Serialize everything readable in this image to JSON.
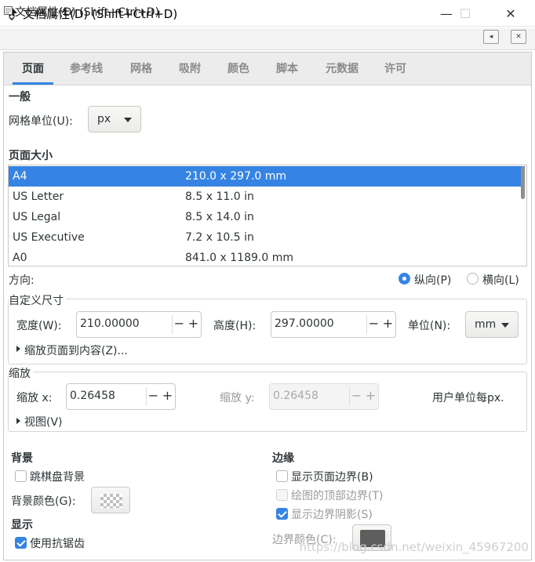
{
  "window": {
    "title": "文档属性(D) (Shift+Ctrl+D)",
    "minimize_glyph": "—",
    "maximize_glyph": "☐",
    "close_glyph": "✕"
  },
  "dock": {
    "title": "文档属性(D) (Shift+Ctrl+D)",
    "btn_float_glyph": "◂",
    "btn_close_glyph": "✕"
  },
  "tabs": [
    "页面",
    "参考线",
    "网格",
    "吸附",
    "颜色",
    "脚本",
    "元数据",
    "许可"
  ],
  "general": {
    "title": "一般",
    "unit_label": "网格单位(U):",
    "unit_value": "px"
  },
  "page_size": {
    "title": "页面大小",
    "rows": [
      {
        "name": "A4",
        "size": "210.0 x 297.0 mm"
      },
      {
        "name": "US Letter",
        "size": "8.5 x 11.0 in"
      },
      {
        "name": "US Legal",
        "size": "8.5 x 14.0 in"
      },
      {
        "name": "US Executive",
        "size": "7.2 x 10.5 in"
      },
      {
        "name": "A0",
        "size": "841.0 x 1189.0 mm"
      }
    ],
    "selected_index": 0
  },
  "orientation": {
    "label": "方向:",
    "portrait": "纵向(P)",
    "landscape": "横向(L)",
    "selected": "portrait"
  },
  "custom_size": {
    "title": "自定义尺寸",
    "width_label": "宽度(W):",
    "width_value": "210.00000",
    "height_label": "高度(H):",
    "height_value": "297.00000",
    "unit_label": "单位(N):",
    "unit_value": "mm",
    "fit_expander": "缩放页面到内容(Z)..."
  },
  "scale": {
    "title": "缩放",
    "x_label": "缩放 x:",
    "x_value": "0.26458",
    "y_label": "缩放 y:",
    "y_value": "0.26458",
    "units_note": "用户单位每px.",
    "view_expander": "视图(V)"
  },
  "background": {
    "title": "背景",
    "checkerboard_label": "跳棋盘背景",
    "checkerboard_checked": false,
    "color_label": "背景颜色(G):"
  },
  "display": {
    "title": "显示",
    "antialias_label": "使用抗锯齿",
    "antialias_checked": true
  },
  "border": {
    "title": "边缘",
    "show_border_label": "显示页面边界(B)",
    "show_border_checked": false,
    "border_on_top_label": "绘图的顶部边界(T)",
    "border_on_top_checked": false,
    "shadow_label": "显示边界阴影(S)",
    "shadow_checked": true,
    "color_label": "边界颜色(C):",
    "color": "#5e5e5e"
  },
  "spin": {
    "minus": "−",
    "plus": "+"
  },
  "watermark": "https://blog.csdn.net/weixin_45967200"
}
